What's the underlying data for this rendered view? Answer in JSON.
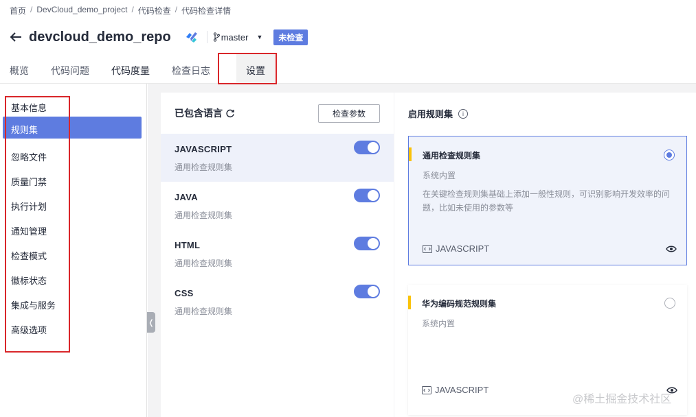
{
  "breadcrumb": [
    "首页",
    "DevCloud_demo_project",
    "代码检查",
    "代码检查详情"
  ],
  "breadcrumb_sep": "/",
  "repo": {
    "title": "devcloud_demo_repo",
    "branch": "master",
    "status_badge": "未检查"
  },
  "tabs": [
    {
      "label": "概览"
    },
    {
      "label": "代码问题"
    },
    {
      "label": "代码度量"
    },
    {
      "label": "检查日志"
    },
    {
      "label": "设置",
      "active": true
    }
  ],
  "leftnav": {
    "items": [
      {
        "label": "基本信息"
      },
      {
        "label": "规则集",
        "active": true
      },
      {
        "label": "忽略文件"
      },
      {
        "label": "质量门禁"
      },
      {
        "label": "执行计划"
      },
      {
        "label": "通知管理"
      },
      {
        "label": "检查模式"
      },
      {
        "label": "徽标状态"
      },
      {
        "label": "集成与服务"
      },
      {
        "label": "高级选项"
      }
    ]
  },
  "languages": {
    "title": "已包含语言",
    "param_button": "检查参数",
    "items": [
      {
        "name": "JAVASCRIPT",
        "ruleset": "通用检查规则集",
        "enabled": true,
        "selected": true
      },
      {
        "name": "JAVA",
        "ruleset": "通用检查规则集",
        "enabled": true
      },
      {
        "name": "HTML",
        "ruleset": "通用检查规则集",
        "enabled": true
      },
      {
        "name": "CSS",
        "ruleset": "通用检查规则集",
        "enabled": true
      }
    ]
  },
  "rulesets": {
    "title": "启用规则集",
    "cards": [
      {
        "title": "通用检查规则集",
        "source": "系统内置",
        "description": "在关键检查规则集基础上添加一般性规则，可识别影响开发效率的问题，比如未使用的参数等",
        "language": "JAVASCRIPT",
        "checked": true
      },
      {
        "title": "华为编码规范规则集",
        "source": "系统内置",
        "description": "",
        "language": "JAVASCRIPT",
        "checked": false
      }
    ]
  },
  "watermark": "@稀土掘金技术社区",
  "colors": {
    "accent": "#5e7ce0",
    "highlight_box": "#d9262a",
    "ruleset_bar": "#fac20a"
  }
}
